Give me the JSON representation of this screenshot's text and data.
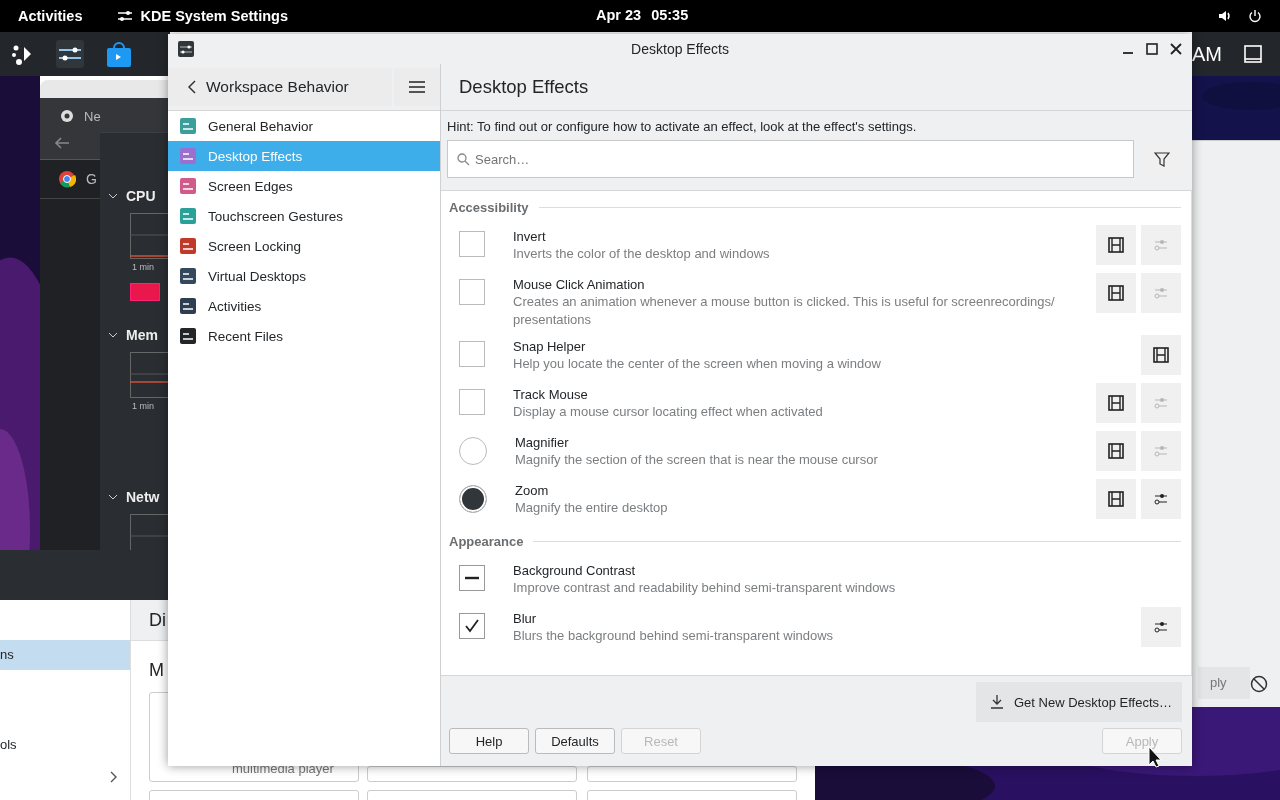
{
  "top_bar": {
    "activities": "Activities",
    "app_name": "KDE System Settings",
    "date": "Apr 23",
    "time": "05:35"
  },
  "background": {
    "browser_tab": "Ne",
    "browser_bookmark": "G",
    "monitor_sections": [
      {
        "label": "CPU",
        "axis": "1 min"
      },
      {
        "label": "Mem",
        "axis": "1 min"
      },
      {
        "label": "Netw"
      }
    ],
    "clock_fragment": "AM",
    "files_header": "Di",
    "files_sidebar": [
      {
        "label": "ns",
        "selected": true
      },
      {
        "label": "ols",
        "selected": false
      }
    ],
    "files_heading": "M",
    "card_caption": "multimedia player",
    "side_button": "ply"
  },
  "window": {
    "title": "Desktop Effects"
  },
  "sidebar": {
    "back_label": "Workspace Behavior",
    "items": [
      {
        "label": "General Behavior",
        "selected": false,
        "color": "#3a9e9a"
      },
      {
        "label": "Desktop Effects",
        "selected": true,
        "color": "#9b6fd0"
      },
      {
        "label": "Screen Edges",
        "selected": false,
        "color": "#d05a8a"
      },
      {
        "label": "Touchscreen Gestures",
        "selected": false,
        "color": "#2aa198"
      },
      {
        "label": "Screen Locking",
        "selected": false,
        "color": "#c0392b"
      },
      {
        "label": "Virtual Desktops",
        "selected": false,
        "color": "#34495e"
      },
      {
        "label": "Activities",
        "selected": false,
        "color": "#2c3e50"
      },
      {
        "label": "Recent Files",
        "selected": false,
        "color": "#232629"
      }
    ]
  },
  "page": {
    "title": "Desktop Effects",
    "hint": "Hint: To find out or configure how to activate an effect, look at the effect's settings.",
    "search": {
      "placeholder": "Search…"
    }
  },
  "groups": [
    {
      "name": "Accessibility",
      "effects": [
        {
          "name": "Invert",
          "description": "Inverts the color of the desktop and windows",
          "kind": "checkbox",
          "checked": false,
          "partial": false,
          "video": true,
          "configure": {
            "disabled": true
          }
        },
        {
          "name": "Mouse Click Animation",
          "description": "Creates an animation whenever a mouse button is clicked. This is useful for screenrecordings/ presentations",
          "kind": "checkbox",
          "checked": false,
          "partial": false,
          "video": true,
          "configure": {
            "disabled": true
          }
        },
        {
          "name": "Snap Helper",
          "description": "Help you locate the center of the screen when moving a window",
          "kind": "checkbox",
          "checked": false,
          "partial": false,
          "video": true
        },
        {
          "name": "Track Mouse",
          "description": "Display a mouse cursor locating effect when activated",
          "kind": "checkbox",
          "checked": false,
          "partial": false,
          "video": true,
          "configure": {
            "disabled": true
          }
        },
        {
          "name": "Magnifier",
          "description": "Magnify the section of the screen that is near the mouse cursor",
          "kind": "radio",
          "checked": false,
          "video": true,
          "configure": {
            "disabled": true
          }
        },
        {
          "name": "Zoom",
          "description": "Magnify the entire desktop",
          "kind": "radio",
          "checked": true,
          "video": true,
          "configure": {
            "disabled": false
          }
        }
      ]
    },
    {
      "name": "Appearance",
      "effects": [
        {
          "name": "Background Contrast",
          "description": "Improve contrast and readability behind semi-transparent windows",
          "kind": "checkbox",
          "checked": true,
          "partial": true,
          "video": false
        },
        {
          "name": "Blur",
          "description": "Blurs the background behind semi-transparent windows",
          "kind": "checkbox",
          "checked": true,
          "partial": false,
          "video": false,
          "configure": {
            "disabled": false
          }
        }
      ]
    }
  ],
  "get_new": "Get New Desktop Effects…",
  "buttons": [
    {
      "label": "Help",
      "disabled": false
    },
    {
      "label": "Defaults",
      "disabled": false
    },
    {
      "label": "Reset",
      "disabled": true
    }
  ],
  "apply": {
    "label": "Apply",
    "disabled": true
  }
}
